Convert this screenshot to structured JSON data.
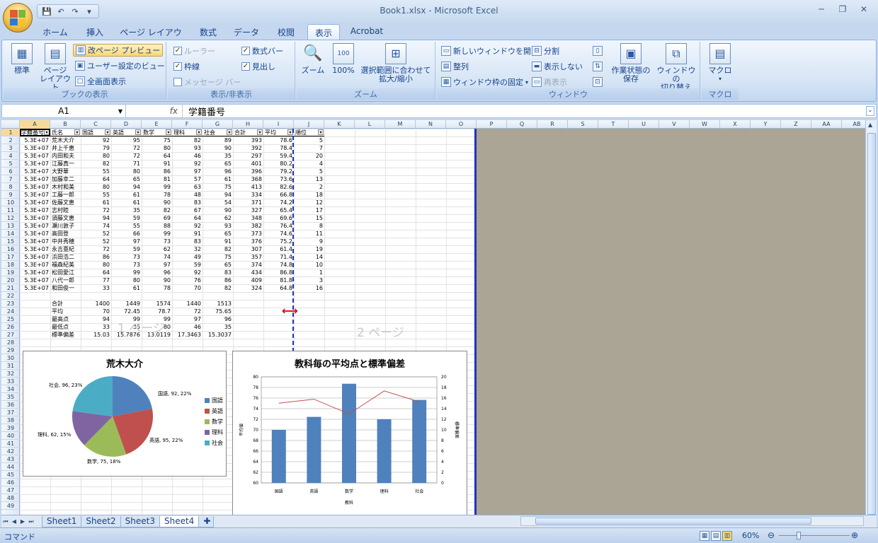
{
  "window": {
    "title": "Book1.xlsx - Microsoft Excel"
  },
  "qat": {
    "save": "💾",
    "undo": "↶",
    "redo": "↷",
    "customize": "▾"
  },
  "tabs": [
    "ホーム",
    "挿入",
    "ページ レイアウト",
    "数式",
    "データ",
    "校閲",
    "表示",
    "Acrobat"
  ],
  "active_tab": "表示",
  "ribbon": {
    "book_view": {
      "label": "ブックの表示",
      "normal": "標準",
      "page_layout": "ページ\nレイアウト",
      "page_break": "改ページ プレビュー",
      "custom_views": "ユーザー設定のビュー",
      "full_screen": "全画面表示"
    },
    "show_hide": {
      "label": "表示/非表示",
      "ruler": "ルーラー",
      "gridlines": "枠線",
      "message_bar": "メッセージ バー",
      "formula_bar": "数式バー",
      "headings": "見出し"
    },
    "zoom": {
      "label": "ズーム",
      "zoom": "ズーム",
      "z100": "100%",
      "zoom_selection": "選択範囲に合わせて\n拡大/縮小"
    },
    "window": {
      "label": "ウィンドウ",
      "new_window": "新しいウィンドウを開く",
      "arrange": "整列",
      "freeze": "ウィンドウ枠の固定",
      "split": "分割",
      "hide": "表示しない",
      "unhide": "再表示",
      "save_ws": "作業状態の\n保存",
      "switch": "ウィンドウの\n切り替え"
    },
    "macro": {
      "label": "マクロ",
      "macro": "マクロ"
    }
  },
  "formula_bar": {
    "name_box": "A1",
    "fx": "fx",
    "value": "学籍番号"
  },
  "columns": [
    "A",
    "B",
    "C",
    "D",
    "E",
    "F",
    "G",
    "H",
    "I",
    "J",
    "K",
    "L",
    "M",
    "N",
    "O",
    "P",
    "Q",
    "R",
    "S",
    "T",
    "U",
    "V",
    "W",
    "X",
    "Y",
    "Z",
    "AA",
    "AB"
  ],
  "header_row": [
    "学籍番号",
    "氏名",
    "国語",
    "英語",
    "数学",
    "理科",
    "社会",
    "合計",
    "平均",
    "順位"
  ],
  "students": [
    [
      "5.3E+07",
      "荒木大介",
      "92",
      "95",
      "75",
      "82",
      "89",
      "393",
      "78.6",
      "5"
    ],
    [
      "5.3E+07",
      "井上千恵",
      "79",
      "72",
      "80",
      "93",
      "90",
      "392",
      "78.4",
      "7"
    ],
    [
      "5.3E+07",
      "内田和夫",
      "80",
      "72",
      "64",
      "46",
      "35",
      "297",
      "59.4",
      "20"
    ],
    [
      "5.3E+07",
      "江藤真一",
      "82",
      "71",
      "91",
      "92",
      "65",
      "401",
      "80.2",
      "4"
    ],
    [
      "5.3E+07",
      "大野華",
      "55",
      "80",
      "86",
      "97",
      "96",
      "396",
      "79.2",
      "5"
    ],
    [
      "5.3E+07",
      "加藤幸二",
      "64",
      "65",
      "81",
      "57",
      "61",
      "368",
      "73.6",
      "13"
    ],
    [
      "5.3E+07",
      "木村和美",
      "80",
      "94",
      "99",
      "63",
      "75",
      "413",
      "82.6",
      "2"
    ],
    [
      "5.3E+07",
      "工藤一郎",
      "55",
      "61",
      "78",
      "48",
      "94",
      "334",
      "66.8",
      "18"
    ],
    [
      "5.3E+07",
      "佐藤文恵",
      "61",
      "61",
      "90",
      "83",
      "54",
      "371",
      "74.2",
      "12"
    ],
    [
      "5.3E+07",
      "志村睦",
      "72",
      "35",
      "82",
      "67",
      "90",
      "327",
      "65.4",
      "17"
    ],
    [
      "5.3E+07",
      "須藤文恵",
      "94",
      "59",
      "69",
      "64",
      "62",
      "348",
      "69.6",
      "15"
    ],
    [
      "5.3E+07",
      "瀬川敦子",
      "74",
      "55",
      "88",
      "92",
      "93",
      "382",
      "76.4",
      "8"
    ],
    [
      "5.3E+07",
      "高田登",
      "52",
      "66",
      "99",
      "91",
      "65",
      "373",
      "74.6",
      "11"
    ],
    [
      "5.3E+07",
      "中井秀穂",
      "52",
      "97",
      "73",
      "83",
      "91",
      "376",
      "75.2",
      "9"
    ],
    [
      "5.3E+07",
      "永吉亜紀",
      "72",
      "59",
      "62",
      "32",
      "82",
      "307",
      "61.4",
      "19"
    ],
    [
      "5.3E+07",
      "浜田浩二",
      "86",
      "73",
      "74",
      "49",
      "75",
      "357",
      "71.4",
      "14"
    ],
    [
      "5.3E+07",
      "福森紀美",
      "80",
      "73",
      "97",
      "59",
      "65",
      "374",
      "74.8",
      "10"
    ],
    [
      "5.3E+07",
      "松田愛江",
      "64",
      "99",
      "96",
      "92",
      "83",
      "434",
      "86.8",
      "1"
    ],
    [
      "5.3E+07",
      "八代一郎",
      "77",
      "80",
      "90",
      "76",
      "86",
      "409",
      "81.8",
      "3"
    ],
    [
      "5.3E+07",
      "和田俊一",
      "33",
      "61",
      "78",
      "70",
      "82",
      "324",
      "64.8",
      "16"
    ]
  ],
  "stats": [
    [
      "合計",
      "1400",
      "1449",
      "1574",
      "1440",
      "1513"
    ],
    [
      "平均",
      "70",
      "72.45",
      "78.7",
      "72",
      "75.65"
    ],
    [
      "最高点",
      "94",
      "99",
      "99",
      "97",
      "96"
    ],
    [
      "最低点",
      "33",
      "35",
      "80",
      "46",
      "35"
    ],
    [
      "標準偏差",
      "15.03",
      "15.7876",
      "13.0119",
      "17.3463",
      "15.3037"
    ]
  ],
  "watermarks": {
    "page1": "1 ページ",
    "page2": "2 ページ"
  },
  "pie": {
    "title": "荒木大介",
    "labels": [
      "国語, 92, 22%",
      "英語, 95, 22%",
      "数学, 75, 18%",
      "理科, 62, 15%",
      "社会, 96, 23%"
    ]
  },
  "bar": {
    "title": "教科毎の平均点と標準偏差",
    "ylabel_left": "平均値",
    "ylabel_right": "標準偏差",
    "xlabel": "教科"
  },
  "chart_data": [
    {
      "type": "pie",
      "title": "荒木大介",
      "categories": [
        "国語",
        "英語",
        "数学",
        "理科",
        "社会"
      ],
      "values": [
        92,
        95,
        75,
        62,
        96
      ],
      "legend": [
        "国語",
        "英語",
        "数学",
        "理科",
        "社会"
      ],
      "colors": [
        "#4f81bd",
        "#c0504d",
        "#9bbb59",
        "#8064a2",
        "#4bacc6"
      ]
    },
    {
      "type": "bar",
      "title": "教科毎の平均点と標準偏差",
      "categories": [
        "国語",
        "英語",
        "数学",
        "理科",
        "社会"
      ],
      "series": [
        {
          "values": [
            70,
            72.45,
            78.7,
            72,
            75.65
          ]
        },
        {
          "values": [
            15.03,
            15.7876,
            13.0119,
            17.3463,
            15.3037
          ]
        }
      ],
      "ylim": [
        60,
        80
      ],
      "y2lim": [
        0,
        20
      ],
      "yticks": [
        "60",
        "62",
        "64",
        "66",
        "68",
        "70",
        "72",
        "74",
        "76",
        "78",
        "80"
      ],
      "y2ticks": [
        "0",
        "2",
        "4",
        "6",
        "8",
        "10",
        "12",
        "14",
        "16",
        "18",
        "20"
      ],
      "xlabel": "教科",
      "ylabel": "平均値",
      "y2label": "標準偏差"
    }
  ],
  "sheets": [
    "Sheet1",
    "Sheet2",
    "Sheet3",
    "Sheet4"
  ],
  "active_sheet": "Sheet4",
  "status": {
    "mode": "コマンド",
    "zoom": "60%"
  }
}
